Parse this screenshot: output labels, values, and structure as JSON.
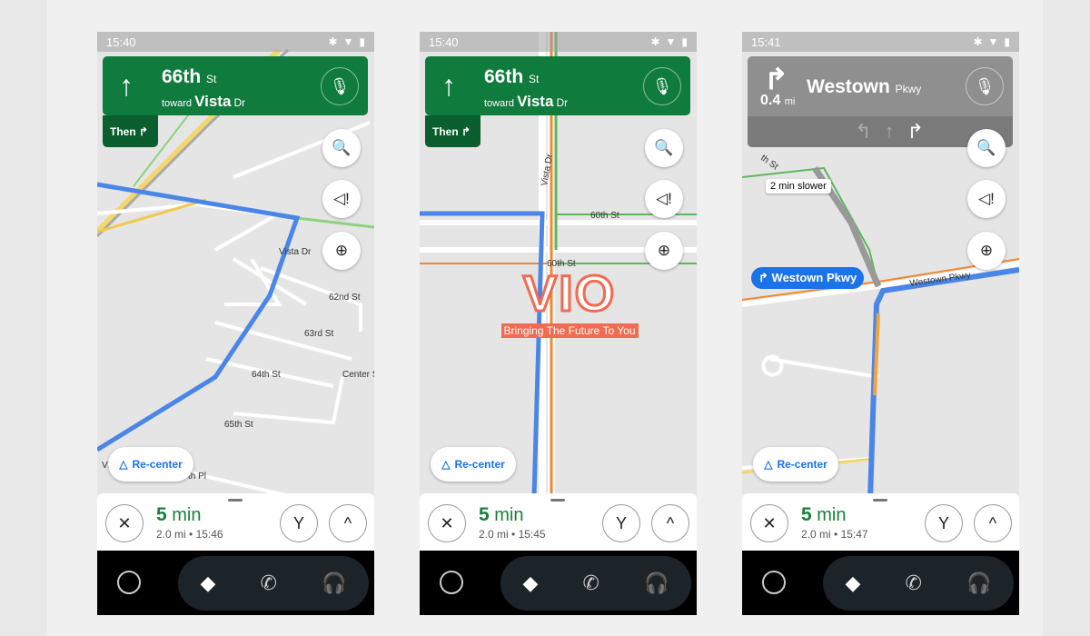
{
  "phones": [
    {
      "time": "15:40",
      "maneuver_icon": "arrow-up",
      "street": "66th",
      "street_suffix": "St",
      "toward_prefix": "toward",
      "toward": "Vista",
      "toward_suffix": "Dr",
      "then_label": "Then",
      "then_icon": "turn-right",
      "recenter": "Re-center",
      "eta": "5",
      "eta_unit": "min",
      "distance": "2.0 mi",
      "arrival": "15:46",
      "map_labels": [
        "62nd St",
        "63rd St",
        "64th St",
        "65th St",
        "Vista Dr",
        "Vista Dr",
        "Center St",
        "th Pl"
      ]
    },
    {
      "time": "15:40",
      "maneuver_icon": "arrow-up",
      "street": "66th",
      "street_suffix": "St",
      "toward_prefix": "toward",
      "toward": "Vista",
      "toward_suffix": "Dr",
      "then_label": "Then",
      "then_icon": "turn-right",
      "recenter": "Re-center",
      "eta": "5",
      "eta_unit": "min",
      "distance": "2.0 mi",
      "arrival": "15:45",
      "map_labels": [
        "60th St",
        "60th St",
        "Vista Dr"
      ],
      "watermark": {
        "logo": "VIO",
        "tagline": "Bringing The Future To You"
      }
    },
    {
      "time": "15:41",
      "maneuver_icon": "turn-right",
      "street": "Westown",
      "street_suffix": "Pkwy",
      "distance_to_turn": "0.4",
      "distance_unit": "mi",
      "lanes": [
        "turn-left",
        "straight",
        "straight-right"
      ],
      "traffic_note": "2 min slower",
      "route_chip": "Westown Pkwy",
      "recenter": "Re-center",
      "eta": "5",
      "eta_unit": "min",
      "distance": "2.0 mi",
      "arrival": "15:47",
      "map_labels": [
        "Westown Pkwy",
        "th St"
      ]
    }
  ],
  "colors": {
    "banner_green": "#0f7b3d",
    "banner_gray": "#8f8f8f",
    "route_blue": "#4a86e8",
    "eta_green": "#188038",
    "accent_blue": "#1a73e8"
  }
}
